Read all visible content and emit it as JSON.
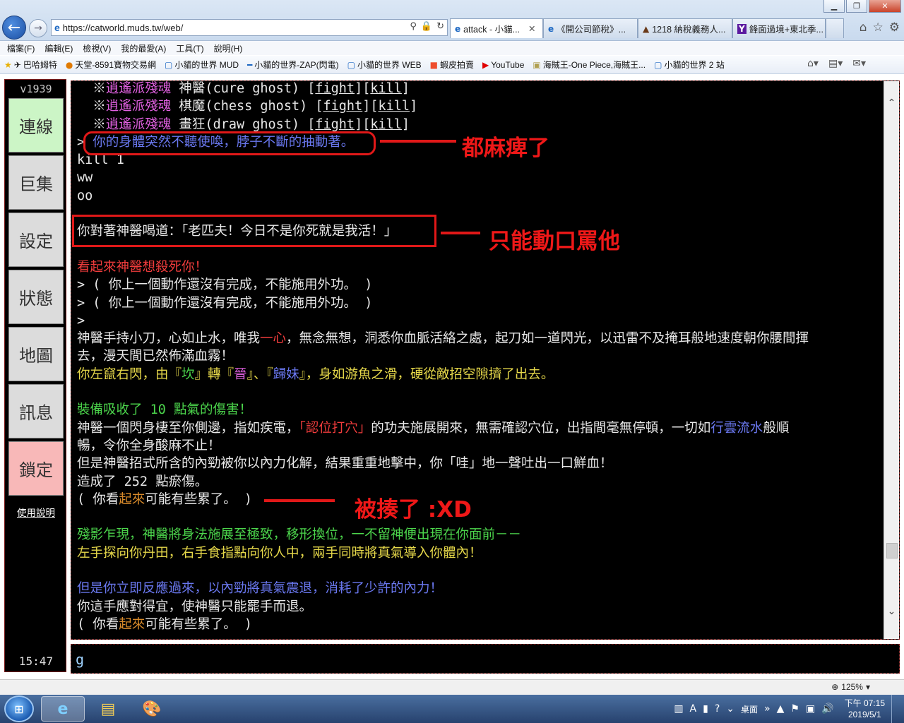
{
  "browser": {
    "url": "https://catworld.muds.tw/web/",
    "tabs": [
      {
        "label": "attack - 小貓...",
        "active": true
      },
      {
        "label": "《開公司節稅》..."
      },
      {
        "label": "1218 納稅義務人..."
      },
      {
        "label": "鋒面過境+東北季..."
      }
    ],
    "menu": [
      "檔案(F)",
      "編輯(E)",
      "檢視(V)",
      "我的最愛(A)",
      "工具(T)",
      "說明(H)"
    ],
    "favorites": [
      "巴哈姆特",
      "天堂-8591寶物交易網",
      "小貓的世界 MUD",
      "小貓的世界-ZAP(閃電)",
      "小貓的世界 WEB",
      "蝦皮拍賣",
      "YouTube",
      "海賊王-One Piece,海賊王...",
      "小貓的世界 2 站"
    ],
    "zoom": "125%"
  },
  "client": {
    "version": "v1939",
    "buttons": [
      {
        "label": "連線",
        "color": "#ccf5c6"
      },
      {
        "label": "巨集",
        "color": "#dcdcdc"
      },
      {
        "label": "設定",
        "color": "#dcdcdc"
      },
      {
        "label": "狀態",
        "color": "#dcdcdc"
      },
      {
        "label": "地圖",
        "color": "#dcdcdc"
      },
      {
        "label": "訊息",
        "color": "#dcdcdc"
      },
      {
        "label": "鎖定",
        "color": "#f8b8b8"
      }
    ],
    "help": "使用說明",
    "clock": "15:47",
    "input_value": "g"
  },
  "terminal": {
    "lines": [
      [
        [
          "  ※",
          "w"
        ],
        [
          "逍遙派殘魂",
          "m"
        ],
        [
          " 神醫(cure ghost) [",
          "w"
        ],
        [
          "fight",
          "w",
          "ul"
        ],
        [
          "][",
          "w"
        ],
        [
          "kill",
          "w",
          "ul"
        ],
        [
          "]",
          "w"
        ]
      ],
      [
        [
          "  ※",
          "w"
        ],
        [
          "逍遙派殘魂",
          "m"
        ],
        [
          " 棋魔(chess ghost) [",
          "w"
        ],
        [
          "fight",
          "w",
          "ul"
        ],
        [
          "][",
          "w"
        ],
        [
          "kill",
          "w",
          "ul"
        ],
        [
          "]",
          "w"
        ]
      ],
      [
        [
          "  ※",
          "w"
        ],
        [
          "逍遙派殘魂",
          "m"
        ],
        [
          " 畫狂(draw ghost) [",
          "w"
        ],
        [
          "fight",
          "w",
          "ul"
        ],
        [
          "][",
          "w"
        ],
        [
          "kill",
          "w",
          "ul"
        ],
        [
          "]",
          "w"
        ]
      ],
      [
        [
          "> ",
          "w"
        ],
        [
          "你的身體突然不聽使喚，脖子不斷的抽動著。",
          "b"
        ]
      ],
      [
        [
          "kill 1",
          "w"
        ]
      ],
      [
        [
          "ww",
          "w"
        ]
      ],
      [
        [
          "oo",
          "w"
        ]
      ],
      [
        [
          "",
          "w"
        ]
      ],
      [
        [
          "你對著神醫喝道：「老匹夫！今日不是你死就是我活！」",
          "w"
        ]
      ],
      [
        [
          "",
          "w"
        ]
      ],
      [
        [
          "看起來神醫想殺死你！",
          "r"
        ]
      ],
      [
        [
          "> ( 你上一個動作還沒有完成，不能施用外功。 )",
          "w"
        ]
      ],
      [
        [
          "> ( 你上一個動作還沒有完成，不能施用外功。 )",
          "w"
        ]
      ],
      [
        [
          ">",
          "w"
        ]
      ],
      [
        [
          "神醫手持小刀，心如止水，唯我",
          "w"
        ],
        [
          "一心",
          "r"
        ],
        [
          "，無念無想，洞悉你血脈活絡之處，起刀如一道閃光，以迅雷不及掩耳般地速度朝你腰間揮",
          "w"
        ]
      ],
      [
        [
          "去，漫天間已然佈滿血霧！",
          "w"
        ]
      ],
      [
        [
          "你左竄右閃，由『",
          "y"
        ],
        [
          "坎",
          "g"
        ],
        [
          "』轉『",
          "y"
        ],
        [
          "晉",
          "m"
        ],
        [
          "』、『",
          "y"
        ],
        [
          "歸妹",
          "b"
        ],
        [
          "』，身如游魚之滑，硬從敵招空隙擠了出去。",
          "y"
        ]
      ],
      [
        [
          "",
          "w"
        ]
      ],
      [
        [
          "裝備吸收了 10 點氣的傷害！",
          "g"
        ]
      ],
      [
        [
          "神醫一個閃身棲至你側邊，指如疾電，",
          "w"
        ],
        [
          "「認位打穴」",
          "r"
        ],
        [
          "的功夫施展開來，無需確認穴位，出指間毫無停頓，一切如",
          "w"
        ],
        [
          "行雲流水",
          "b"
        ],
        [
          "般順",
          "w"
        ]
      ],
      [
        [
          "暢，令你全身酸麻不止！",
          "w"
        ]
      ],
      [
        [
          "但是神醫招式所含的內勁被你以內力化解，結果重重地擊中，你「哇」地一聲吐出一口鮮血！",
          "w"
        ]
      ],
      [
        [
          "造成了 252 點瘀傷。",
          "w"
        ]
      ],
      [
        [
          "( 你看",
          "w"
        ],
        [
          "起來",
          "o"
        ],
        [
          "可能有些累了。 )",
          "w"
        ]
      ],
      [
        [
          "",
          "w"
        ]
      ],
      [
        [
          "殘影乍現，神醫將身法施展至極致，移形換位，一不留神便出現在你面前－－",
          "g"
        ]
      ],
      [
        [
          "左手探向你丹田，右手食指點向你人中，兩手同時將真氣導入你體內！",
          "y"
        ]
      ],
      [
        [
          "",
          "w"
        ]
      ],
      [
        [
          "但是你立即反應過來，以內勁將真氣震退，消耗了少許的內力！",
          "b"
        ]
      ],
      [
        [
          "你這手應對得宜，使神醫只能罷手而退。",
          "w"
        ]
      ],
      [
        [
          "( 你看",
          "w"
        ],
        [
          "起來",
          "o"
        ],
        [
          "可能有些累了。 )",
          "w"
        ]
      ]
    ]
  },
  "annotations": {
    "numb": "都麻痺了",
    "curse": "只能動口罵他",
    "beaten": "被揍了 :XD"
  },
  "taskbar": {
    "desktop_label": "桌面",
    "time": "下午 07:15",
    "date": "2019/5/1"
  }
}
